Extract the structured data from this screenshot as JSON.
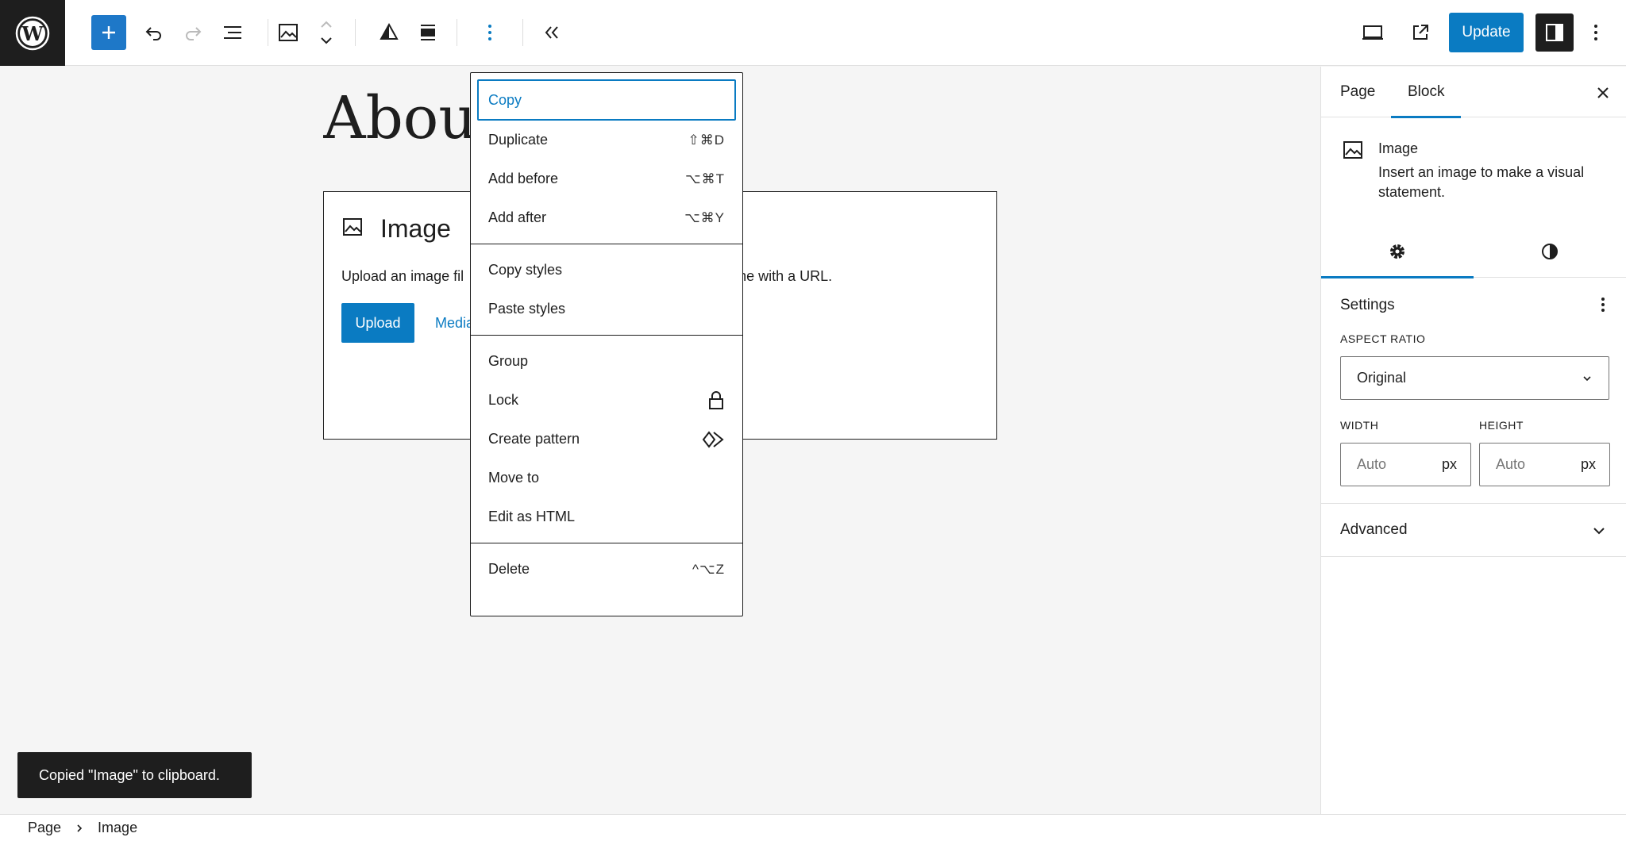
{
  "toolbar": {
    "update_label": "Update"
  },
  "canvas": {
    "page_title": "About",
    "placeholder": {
      "title": "Image",
      "instructions_left": "Upload an image fil",
      "instructions_right": "l one with a URL.",
      "upload_label": "Upload",
      "media_label": "Media"
    }
  },
  "menu": {
    "groups": [
      [
        {
          "label": "Copy",
          "shortcut": ""
        },
        {
          "label": "Duplicate",
          "shortcut": "⇧⌘D"
        },
        {
          "label": "Add before",
          "shortcut": "⌥⌘T"
        },
        {
          "label": "Add after",
          "shortcut": "⌥⌘Y"
        }
      ],
      [
        {
          "label": "Copy styles",
          "shortcut": ""
        },
        {
          "label": "Paste styles",
          "shortcut": ""
        }
      ],
      [
        {
          "label": "Group",
          "shortcut": ""
        },
        {
          "label": "Lock",
          "shortcut": "",
          "icon": "lock-icon"
        },
        {
          "label": "Create pattern",
          "shortcut": "",
          "icon": "pattern-icon"
        },
        {
          "label": "Move to",
          "shortcut": ""
        },
        {
          "label": "Edit as HTML",
          "shortcut": ""
        }
      ],
      [
        {
          "label": "Delete",
          "shortcut": "^⌥Z"
        }
      ]
    ]
  },
  "sidebar": {
    "tabs": {
      "page": "Page",
      "block": "Block"
    },
    "block_card": {
      "title": "Image",
      "description": "Insert an image to make a visual statement."
    },
    "settings": {
      "heading": "Settings",
      "aspect_ratio_label": "ASPECT RATIO",
      "aspect_ratio_value": "Original",
      "width_label": "WIDTH",
      "height_label": "HEIGHT",
      "width_placeholder": "Auto",
      "height_placeholder": "Auto",
      "unit": "px"
    },
    "advanced_label": "Advanced"
  },
  "snackbar": {
    "message": "Copied \"Image\" to clipboard."
  },
  "breadcrumb": {
    "items": [
      "Page",
      "Image"
    ]
  },
  "colors": {
    "accent": "#0a7bc2",
    "dark": "#1e1e1e"
  }
}
